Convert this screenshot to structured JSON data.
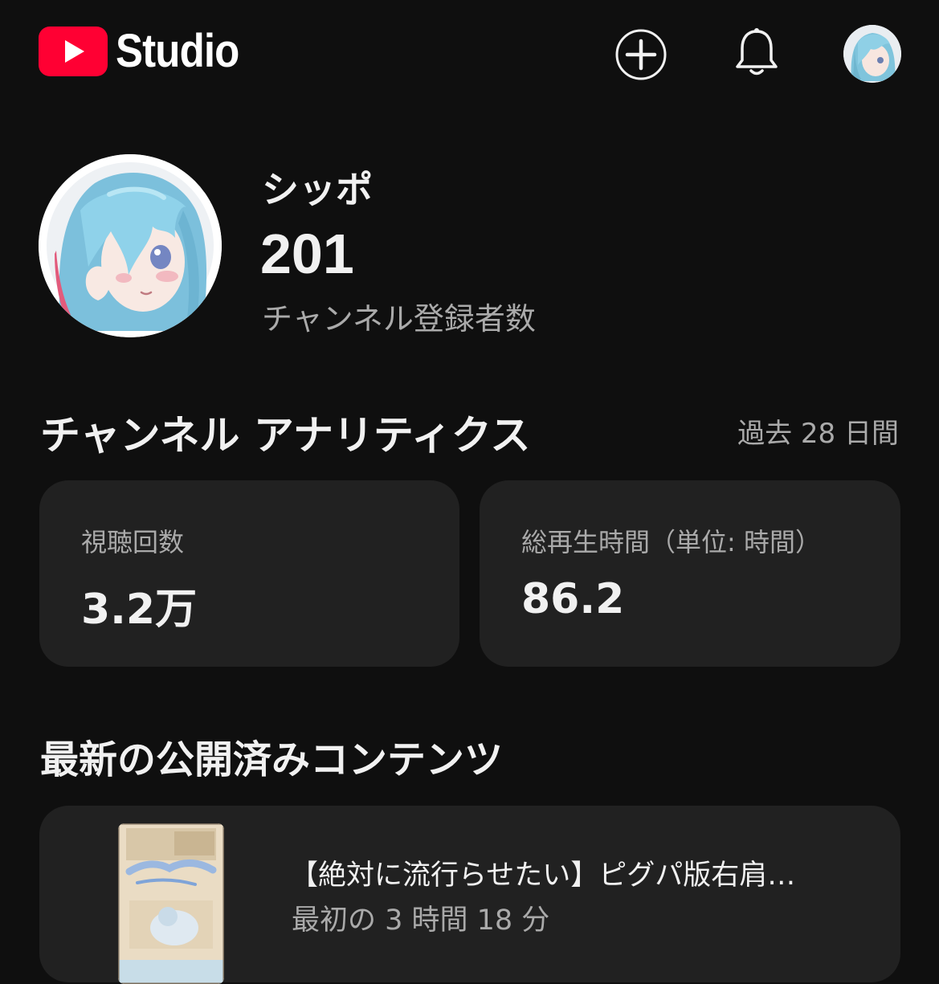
{
  "header": {
    "logo_text": "Studio",
    "icons": {
      "logo": "youtube-play-icon",
      "create": "plus-circle-icon",
      "notifications": "bell-icon",
      "account": "account-avatar"
    },
    "brand_color": "#ff0033"
  },
  "channel": {
    "name": "シッポ",
    "subscriber_count": "201",
    "subscriber_label": "チャンネル登録者数"
  },
  "analytics": {
    "title": "チャンネル アナリティクス",
    "period": "過去 28 日間",
    "cards": [
      {
        "label": "視聴回数",
        "value": "3.2万"
      },
      {
        "label": "総再生時間（単位: 時間）",
        "value": "86.2"
      }
    ]
  },
  "latest": {
    "title": "最新の公開済みコンテンツ",
    "video": {
      "title": "【絶対に流行らせたい】ピグパ版右肩…",
      "meta": "最初の 3 時間 18 分"
    }
  },
  "colors": {
    "background": "#0f0f0f",
    "card": "#212121",
    "text_primary": "#f1f1f1",
    "text_secondary": "#aaaaaa"
  }
}
